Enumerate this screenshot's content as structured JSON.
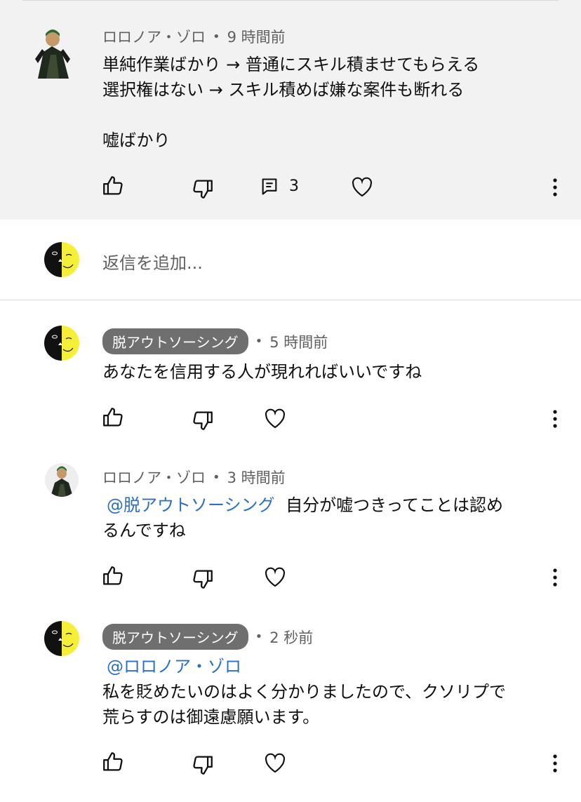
{
  "colors": {
    "top_bg": "#f2f2f2",
    "badge_bg": "#6f6f6f",
    "mention": "#2a6fc9",
    "meta": "#606060"
  },
  "main_comment": {
    "author": "ロロノア・ゾロ",
    "time": "9 時間前",
    "lines": [
      "単純作業ばかり → 普通にスキル積ませてもらえる",
      "選択権はない → スキル積めば嫌な案件も断れる",
      "",
      "嘘ばかり"
    ],
    "reply_count": "3",
    "icons": [
      "thumbs-up-icon",
      "thumbs-down-icon",
      "reply-icon",
      "heart-icon",
      "more-vert-icon"
    ]
  },
  "reply_box": {
    "placeholder": "返信を追加..."
  },
  "replies": [
    {
      "author": "脱アウトソーシング",
      "time": "5 時間前",
      "mention": "",
      "text": "あなたを信用する人が現れればいいですね"
    },
    {
      "author": "ロロノア・ゾロ",
      "time": "3 時間前",
      "mention": "@脱アウトソーシング",
      "text_inline": "自分が嘘つきってことは認め",
      "text": "るんですね"
    },
    {
      "author": "脱アウトソーシング",
      "time": "2 秒前",
      "mention": "@ロロノア・ゾロ",
      "text": "私を貶めたいのはよく分かりましたので、クソリプで\n荒らすのは御遠慮願います。"
    }
  ]
}
